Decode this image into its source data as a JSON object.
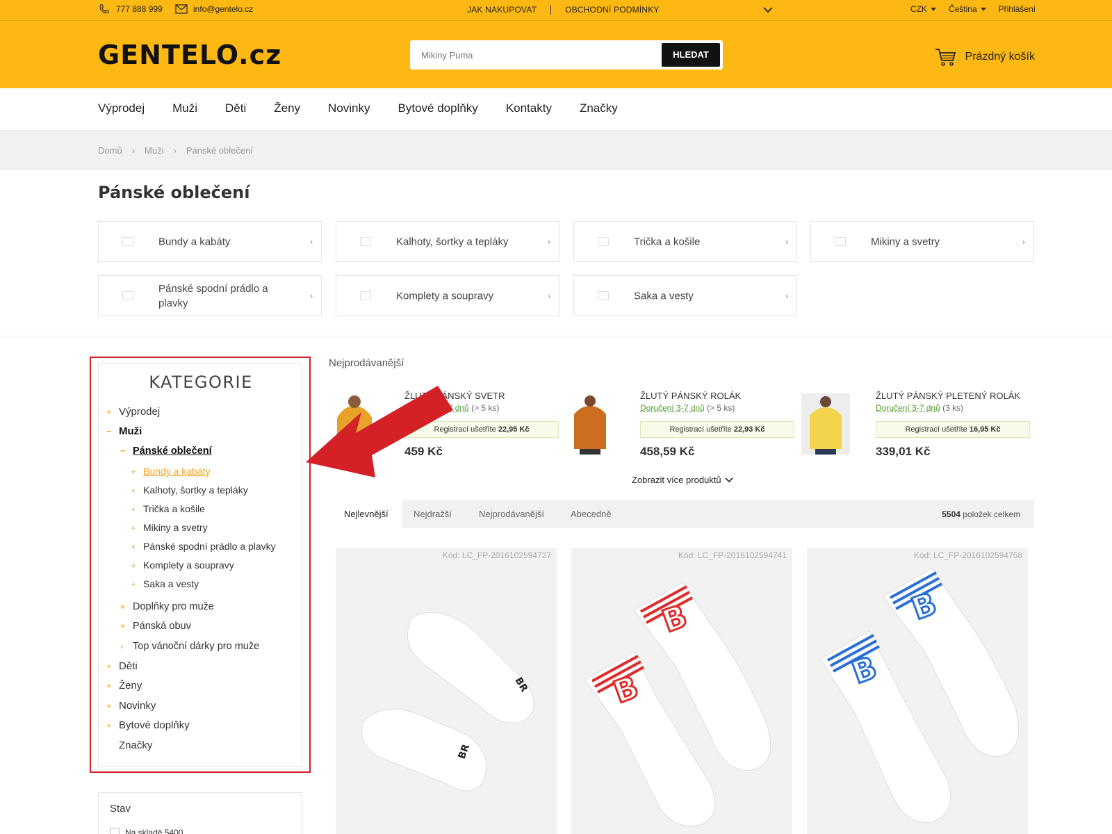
{
  "topbar": {
    "phone": "777 888 999",
    "email": "info@gentelo.cz",
    "links": [
      "JAK NAKUPOVAT",
      "OBCHODNÍ PODMÍNKY"
    ],
    "currency": "CZK",
    "language": "Čeština",
    "login": "Přihlášení"
  },
  "header": {
    "logo": "GENTELO.cz",
    "search_placeholder": "Mikiny Puma",
    "search_button": "HLEDAT",
    "cart_label": "Prázdný košík"
  },
  "nav": [
    "Výprodej",
    "Muži",
    "Děti",
    "Ženy",
    "Novinky",
    "Bytové doplňky",
    "Kontakty",
    "Značky"
  ],
  "breadcrumb": [
    "Domů",
    "Muži",
    "Pánské oblečení"
  ],
  "page_title": "Pánské oblečení",
  "tiles": [
    "Bundy a kabáty",
    "Kalhoty, šortky a tepláky",
    "Trička a košile",
    "Mikiny a svetry",
    "Pánské spodní prádlo a plavky",
    "Komplety a soupravy",
    "Saka a vesty"
  ],
  "sidebar": {
    "title": "KATEGORIE",
    "items": {
      "vyprodej": "Výprodej",
      "muzi": "Muži",
      "panske_obleceni": "Pánské oblečení",
      "bundy": "Bundy a kabáty",
      "kalhoty": "Kalhoty, šortky a tepláky",
      "tricka": "Trička a košile",
      "mikiny": "Mikiny a svetry",
      "pradlo": "Pánské spodní prádlo a plavky",
      "komplety": "Komplety a soupravy",
      "saka": "Saka a vesty",
      "doplnky": "Doplňky pro muže",
      "obuv": "Pánská obuv",
      "vanocni": "Top vánoční dárky pro muže",
      "deti": "Děti",
      "zeny": "Ženy",
      "novinky": "Novinky",
      "bytove": "Bytové doplňky",
      "znacky": "Značky"
    },
    "filter_title": "Stav",
    "filter_option": "Na skladě",
    "filter_count": "5400"
  },
  "bestsellers": {
    "title": "Nejprodávanější",
    "show_more": "Zobrazit více produktů",
    "items": [
      {
        "name": "ŽLUTÝ PÁNSKÝ SVETR",
        "delivery": "Doručení 3-7 dnů",
        "qty": "(> 5 ks)",
        "reg_prefix": "Registrací ušetříte",
        "reg_amount": "22,95 Kč",
        "price": "459 Kč",
        "thumb_color": "#e8a22a"
      },
      {
        "name": "ŽLUTÝ PÁNSKÝ ROLÁK",
        "delivery": "Doručení 3-7 dnů",
        "qty": "(> 5 ks)",
        "reg_prefix": "Registrací ušetříte",
        "reg_amount": "22,93 Kč",
        "price": "458,59 Kč",
        "thumb_color": "#cc6d1f"
      },
      {
        "name": "ŽLUTÝ PÁNSKÝ PLETENÝ ROLÁK",
        "delivery": "Doručení 3-7 dnů",
        "qty": "(3 ks)",
        "reg_prefix": "Registrací ušetříte",
        "reg_amount": "16,95 Kč",
        "price": "339,01 Kč",
        "thumb_color": "#f2d54c"
      }
    ]
  },
  "sorting": {
    "tabs": [
      "Nejlevnější",
      "Nejdražší",
      "Nejprodávanější",
      "Abecedně"
    ],
    "active": "Nejlevnější",
    "total_count": "5504",
    "total_label": "položek celkem"
  },
  "products": [
    {
      "code": "Kód: LC_FP-2016102594727",
      "stripe_color": "#222222"
    },
    {
      "code": "Kód: LC_FP-2016102594741",
      "stripe_color": "#e02a2a"
    },
    {
      "code": "Kód: LC_FP-2016102594758",
      "stripe_color": "#2a6fd6"
    }
  ],
  "colors": {
    "brand_yellow": "#fdb813",
    "annotation_red": "#d42027",
    "accent_orange": "#f5a623"
  }
}
